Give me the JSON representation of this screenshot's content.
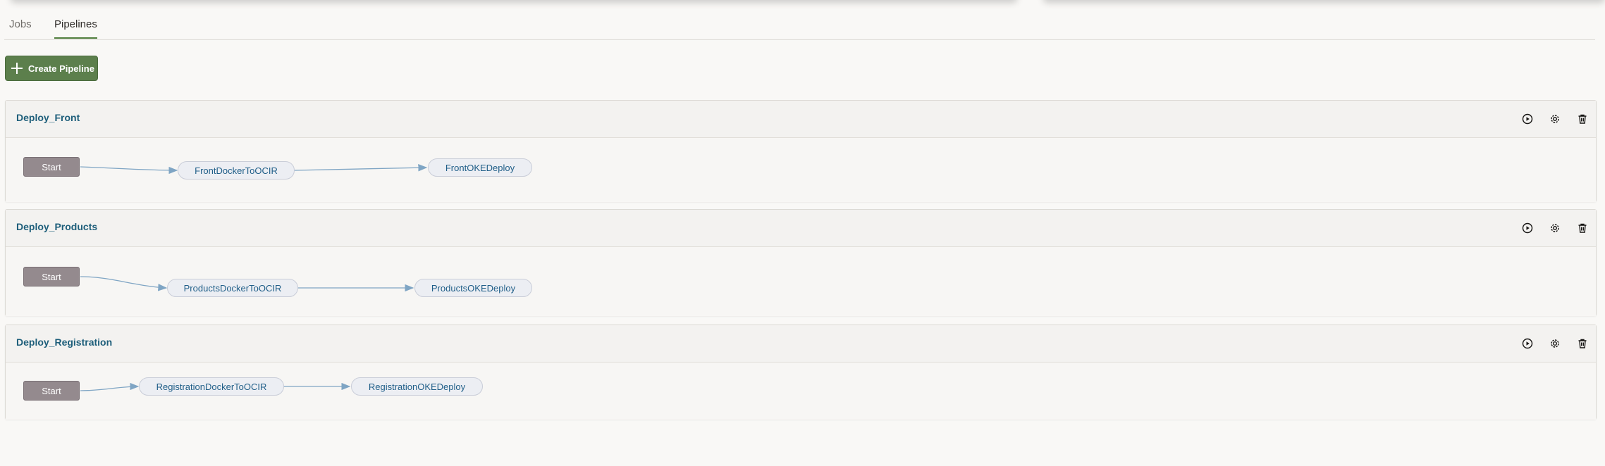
{
  "tabs": [
    {
      "label": "Jobs",
      "active": false
    },
    {
      "label": "Pipelines",
      "active": true
    }
  ],
  "create_button": {
    "label": "Create Pipeline",
    "icon": "plus-icon"
  },
  "pipelines": [
    {
      "name": "Deploy_Front",
      "start_label": "Start",
      "stages": [
        "FrontDockerToOCIR",
        "FrontOKEDeploy"
      ]
    },
    {
      "name": "Deploy_Products",
      "start_label": "Start",
      "stages": [
        "ProductsDockerToOCIR",
        "ProductsOKEDeploy"
      ]
    },
    {
      "name": "Deploy_Registration",
      "start_label": "Start",
      "stages": [
        "RegistrationDockerToOCIR",
        "RegistrationOKEDeploy"
      ]
    }
  ],
  "actions": {
    "run": "play-icon",
    "settings": "gear-icon",
    "delete": "trash-icon"
  },
  "colors": {
    "accent": "#5c7f4c",
    "link": "#1d5e7a",
    "start_node": "#948a8e",
    "edge": "#7fa5c4"
  }
}
